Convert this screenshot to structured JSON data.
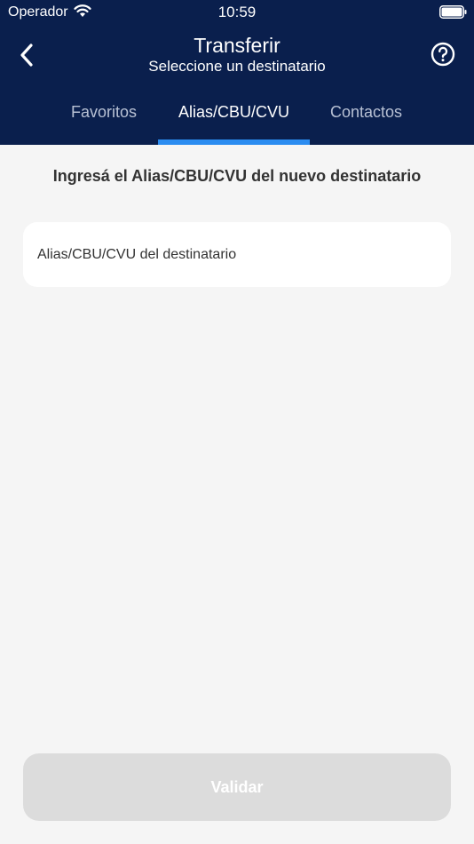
{
  "status_bar": {
    "carrier": "Operador",
    "time": "10:59"
  },
  "header": {
    "title": "Transferir",
    "subtitle": "Seleccione un destinatario"
  },
  "tabs": [
    {
      "label": "Favoritos",
      "selected": false
    },
    {
      "label": "Alias/CBU/CVU",
      "selected": true
    },
    {
      "label": "Contactos",
      "selected": false
    }
  ],
  "main": {
    "instruction": "Ingresá el Alias/CBU/CVU del nuevo destinatario",
    "input_placeholder": "Alias/CBU/CVU del destinatario",
    "input_value": ""
  },
  "footer": {
    "validate_label": "Validar",
    "validate_enabled": false
  },
  "colors": {
    "header_bg": "#0a1f4d",
    "tab_indicator": "#2b8cf0",
    "page_bg": "#f5f5f5",
    "button_disabled": "#dcdcdc"
  },
  "icons": [
    "wifi-icon",
    "battery-icon",
    "back-arrow-icon",
    "help-icon"
  ]
}
